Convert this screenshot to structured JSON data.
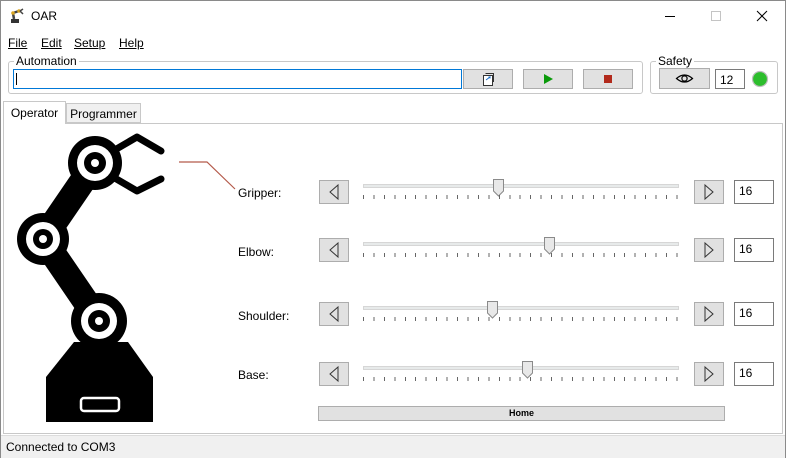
{
  "window": {
    "title": "OAR",
    "controls": [
      "minimize-icon",
      "maximize-icon",
      "close-icon"
    ]
  },
  "menu": {
    "file": "File",
    "edit": "Edit",
    "setup": "Setup",
    "help": "Help"
  },
  "automation": {
    "legend": "Automation",
    "script_value": "",
    "open_icon": "open-file-icon",
    "play_icon": "play-icon",
    "stop_icon": "stop-icon"
  },
  "safety": {
    "legend": "Safety",
    "view_icon": "eye-icon",
    "value": "12",
    "status_color": "#2dbe2d"
  },
  "tabs": {
    "operator": "Operator",
    "programmer": "Programmer",
    "active": "Operator"
  },
  "joints": [
    {
      "label": "Gripper:",
      "value": "16",
      "level": 0.43
    },
    {
      "label": "Elbow:",
      "value": "16",
      "level": 0.59
    },
    {
      "label": "Shoulder:",
      "value": "16",
      "level": 0.41
    },
    {
      "label": "Base:",
      "value": "16",
      "level": 0.52
    }
  ],
  "home_button": "Home",
  "status": "Connected to COM3",
  "colors": {
    "play": "#0a9a0a",
    "stop": "#b22a1c",
    "accent": "#0078d7",
    "callout_line": "#b45a4a"
  }
}
